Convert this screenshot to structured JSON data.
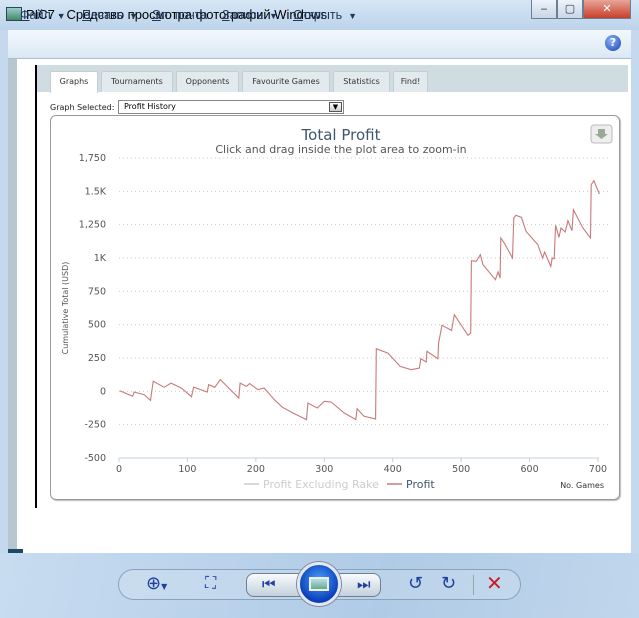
{
  "window": {
    "title": "PIC7 - Средство просмотра фотографий Windows",
    "min": "‒",
    "max": "▢",
    "close": "✕"
  },
  "menu": [
    {
      "key": "Ф",
      "rest": "айл",
      "dropdown": true
    },
    {
      "key": "П",
      "rest": "ечать",
      "dropdown": true
    },
    {
      "key": "Э",
      "rest": "л. почта",
      "dropdown": false
    },
    {
      "key": "З",
      "rest": "апись",
      "dropdown": true
    },
    {
      "key": "О",
      "rest": "ткрыть",
      "dropdown": true
    }
  ],
  "help": "?",
  "tabs": [
    "Graphs",
    "Tournaments",
    "Opponents",
    "Favourite Games",
    "Statistics",
    "Find!"
  ],
  "graph_selected": {
    "label": "Graph Selected:",
    "value": "Profit History"
  },
  "chart_data": {
    "type": "line",
    "title": "Total Profit",
    "subtitle": "Click and drag inside the plot area to zoom-in",
    "xlabel": "No. Games",
    "ylabel": "Cumulative Total (USD)",
    "xlim": [
      0,
      700
    ],
    "ylim": [
      -500,
      1750
    ],
    "xticks": [
      0,
      100,
      200,
      300,
      400,
      500,
      600,
      700
    ],
    "yticks": [
      {
        "v": 1750,
        "l": "1,750"
      },
      {
        "v": 1500,
        "l": "1.5K"
      },
      {
        "v": 1250,
        "l": "1,250"
      },
      {
        "v": 1000,
        "l": "1K"
      },
      {
        "v": 750,
        "l": "750"
      },
      {
        "v": 500,
        "l": "500"
      },
      {
        "v": 250,
        "l": "250"
      },
      {
        "v": 0,
        "l": "0"
      },
      {
        "v": -250,
        "l": "-250"
      },
      {
        "v": -500,
        "l": "-500"
      }
    ],
    "grid": true,
    "legend": [
      {
        "name": "Profit Excluding Rake",
        "color": "#cccccc",
        "hidden": true
      },
      {
        "name": "Profit",
        "color": "#c87a7a"
      }
    ],
    "legend_position": "bottom-center",
    "series": [
      {
        "name": "Profit",
        "color": "#c87a7a",
        "x": [
          1,
          20,
          22,
          37,
          46,
          50,
          66,
          76,
          91,
          106,
          109,
          129,
          131,
          140,
          148,
          175,
          177,
          186,
          191,
          203,
          212,
          227,
          239,
          254,
          274,
          276,
          290,
          300,
          310,
          329,
          346,
          348,
          358,
          375,
          376,
          393,
          411,
          427,
          439,
          441,
          449,
          450,
          466,
          467,
          472,
          486,
          490,
          510,
          514,
          515,
          522,
          528,
          532,
          544,
          550,
          554,
          557,
          558,
          563,
          575,
          577,
          580,
          588,
          595,
          612,
          619,
          622,
          631,
          633,
          636,
          638,
          643,
          646,
          652,
          656,
          662,
          664,
          678,
          689,
          690,
          694,
          702
        ],
        "y": [
          5,
          -37,
          -5,
          -25,
          -68,
          75,
          30,
          62,
          25,
          -40,
          32,
          -5,
          50,
          30,
          88,
          -50,
          62,
          37,
          58,
          12,
          25,
          -62,
          -120,
          -162,
          -212,
          -88,
          -125,
          -75,
          -80,
          -162,
          -212,
          -130,
          -187,
          -207,
          320,
          287,
          187,
          162,
          175,
          245,
          220,
          300,
          245,
          362,
          495,
          457,
          575,
          420,
          437,
          980,
          975,
          1025,
          950,
          875,
          837,
          895,
          850,
          1150,
          1112,
          1000,
          1300,
          1320,
          1305,
          1200,
          1100,
          1000,
          1045,
          937,
          1000,
          995,
          1245,
          1155,
          1225,
          1195,
          1280,
          1205,
          1362,
          1225,
          1150,
          1550,
          1580,
          1480
        ]
      }
    ],
    "download_icon": "download-icon"
  },
  "toolbar": {
    "icons": [
      "zoom-icon",
      "fit-window-icon",
      "previous-icon",
      "slideshow-icon",
      "next-icon",
      "rotate-left-icon",
      "rotate-right-icon",
      "delete-icon"
    ]
  }
}
